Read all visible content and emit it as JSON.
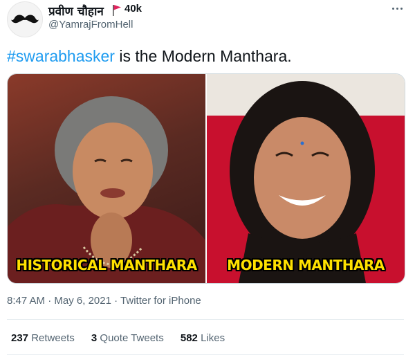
{
  "author": {
    "display_name": "प्रवीण चौहान",
    "follower_count": "40k",
    "handle": "@YamrajFromHell",
    "flag_color": "#e0245e"
  },
  "tweet": {
    "hashtag": "#swarabhasker",
    "text_rest": " is the Modern Manthara."
  },
  "media": {
    "left_caption": "HISTORICAL MANTHARA",
    "right_caption": "MODERN MANTHARA"
  },
  "meta": {
    "time": "8:47 AM",
    "date": "May 6, 2021",
    "source": "Twitter for iPhone"
  },
  "stats": {
    "retweets_count": "237",
    "retweets_label": "Retweets",
    "quotes_count": "3",
    "quotes_label": "Quote Tweets",
    "likes_count": "582",
    "likes_label": "Likes"
  },
  "colors": {
    "link": "#1d9bf0",
    "secondary_text": "#536471",
    "caption": "#ffe100"
  }
}
